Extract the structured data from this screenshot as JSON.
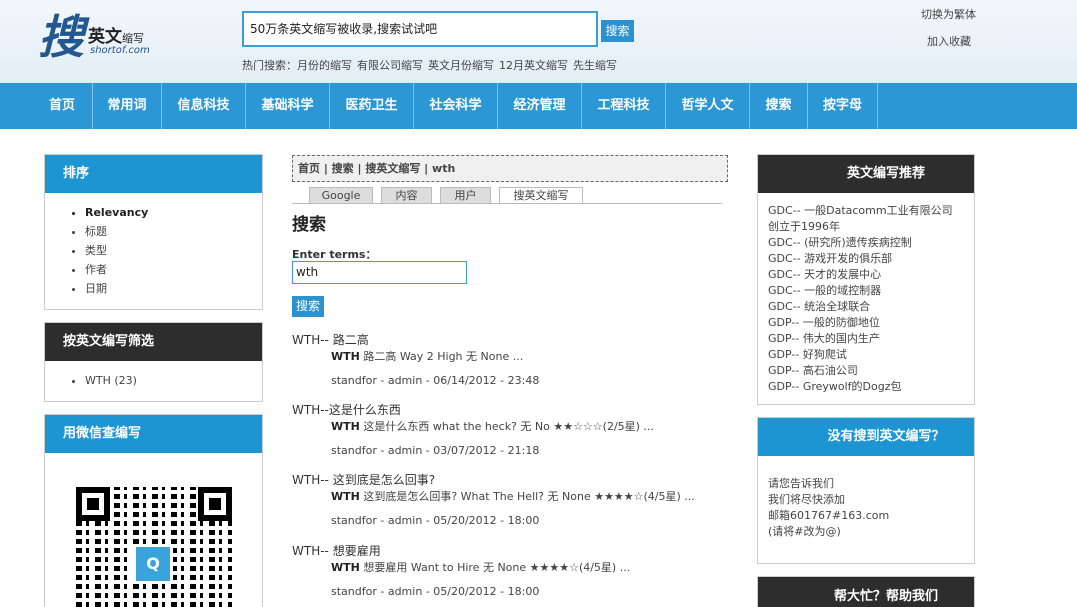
{
  "logo": {
    "glyph": "搜",
    "brand_a": "英文",
    "brand_b": "缩写",
    "domain": "shortof.com"
  },
  "search": {
    "value": "50万条英文缩写被收录,搜索试试吧",
    "button": "搜索"
  },
  "hot": {
    "label": "热门搜索：",
    "items": [
      "月份的缩写",
      "有限公司缩写",
      "英文月份缩写",
      "12月英文缩写",
      "先生缩写"
    ]
  },
  "top_links": {
    "traditional": "切换为繁体",
    "favorite": "加入收藏"
  },
  "nav": [
    "首页",
    "常用词",
    "信息科技",
    "基础科学",
    "医药卫生",
    "社会科学",
    "经济管理",
    "工程科技",
    "哲学人文",
    "搜索",
    "按字母"
  ],
  "sort": {
    "title": "排序",
    "items": [
      "Relevancy",
      "标题",
      "类型",
      "作者",
      "日期"
    ]
  },
  "filter": {
    "title": "按英文编写筛选",
    "items": [
      "WTH (23)"
    ]
  },
  "wechat": {
    "title": "用微信查编写",
    "qr_logo": "Q"
  },
  "breadcrumb": "首页 | 搜索 | 搜英文缩写 | wth",
  "tabs": [
    "Google",
    "内容",
    "用户",
    "搜英文缩写"
  ],
  "main": {
    "heading": "搜索",
    "terms_label": "Enter terms：",
    "terms_value": "wth",
    "search_button": "搜索"
  },
  "results": [
    {
      "title": "WTH-- 路二高",
      "bold": "WTH",
      "desc": " 路二高 Way 2 High 无 None ...",
      "meta": "standfor - admin - 06/14/2012 - 23:48"
    },
    {
      "title": "WTH--这是什么东西",
      "bold": "WTH",
      "desc": " 这是什么东西 what the heck? 无 No ★★☆☆☆(2/5星) ...",
      "meta": "standfor - admin - 03/07/2012 - 21:18"
    },
    {
      "title": "WTH-- 这到底是怎么回事?",
      "bold": "WTH",
      "desc": " 这到底是怎么回事? What The Hell? 无 None ★★★★☆(4/5星) ...",
      "meta": "standfor - admin - 05/20/2012 - 18:00"
    },
    {
      "title": "WTH-- 想要雇用",
      "bold": "WTH",
      "desc": " 想要雇用 Want to Hire 无 None ★★★★☆(4/5星) ...",
      "meta": "standfor - admin - 05/20/2012 - 18:00"
    }
  ],
  "recommend": {
    "title": "英文编写推荐",
    "items": [
      "GDC-- 一般Datacomm工业有限公司",
      "创立于1996年",
      "GDC-- (研究所)遗传疾病控制",
      "GDC-- 游戏开发的俱乐部",
      "GDC-- 天才的发展中心",
      "GDC-- 一般的域控制器",
      "GDC-- 统治全球联合",
      "GDP-- 一般的防御地位",
      "GDP-- 伟大的国内生产",
      "GDP-- 好狗爬试",
      "GDP-- 高石油公司",
      "GDP-- Greywolf的Dogz包"
    ]
  },
  "notfound": {
    "title": "没有搜到英文编写？",
    "lines": [
      "请您告诉我们",
      "我们将尽快添加",
      "邮箱601767#163.com",
      "(请将#改为@)"
    ]
  },
  "help": {
    "title": "帮大忙？帮助我们"
  }
}
